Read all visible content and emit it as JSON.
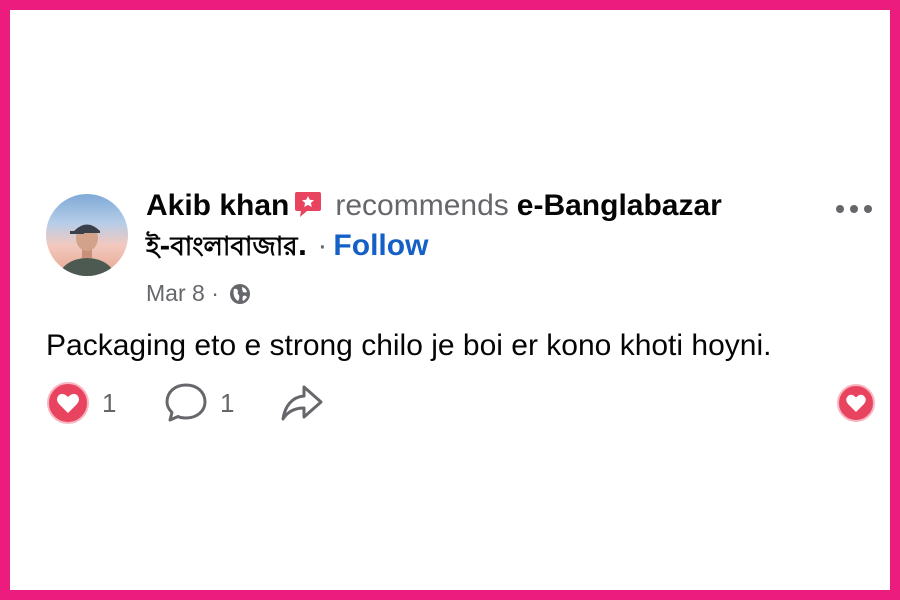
{
  "post": {
    "author": "Akib khan",
    "verb": "recommends",
    "page_name": "e-Banglabazar",
    "page_name_bn": "ই-বাংলাবাজার.",
    "separator": "·",
    "follow_label": "Follow",
    "date": "Mar 8",
    "meta_separator": "·",
    "text": "Packaging eto e strong chilo je boi er kono khoti hoyni."
  },
  "actions": {
    "like_count": "1",
    "comment_count": "1"
  },
  "colors": {
    "frame": "#ec1c7f",
    "follow": "#1560c7",
    "heart": "#e8445f",
    "badge": "#e8445f"
  },
  "icons": {
    "menu": "more-dots-icon",
    "privacy": "globe-icon",
    "like": "heart-icon",
    "comment": "comment-icon",
    "share": "share-icon",
    "badge": "recommend-badge-icon"
  }
}
